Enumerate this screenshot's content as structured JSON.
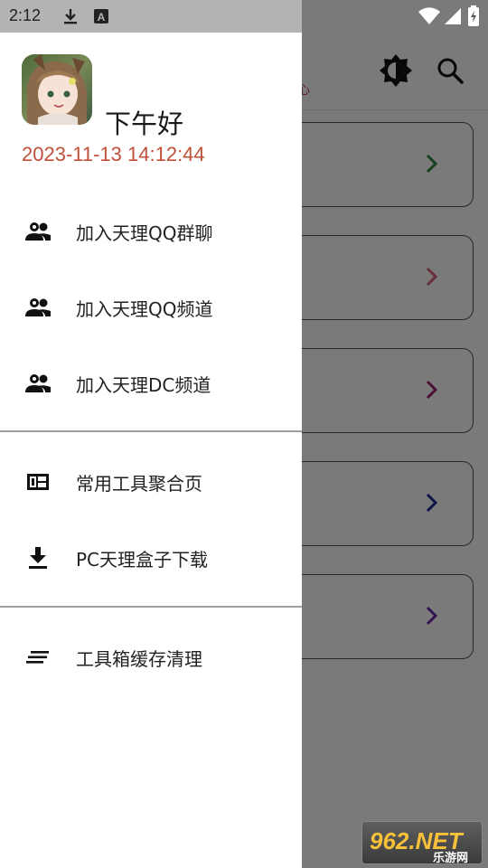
{
  "status_bar": {
    "time": "2:12",
    "icons": [
      "download-icon",
      "a-badge-icon",
      "wifi-icon",
      "signal-icon",
      "battery-icon"
    ]
  },
  "background_app": {
    "toolbar_icons": [
      "theme-toggle-icon",
      "search-icon"
    ],
    "toolbar_subtitle": "心",
    "chevron_colors": [
      "#2e8b3a",
      "#d9607a",
      "#8b2060",
      "#1c2a9a",
      "#5a2a9a"
    ]
  },
  "drawer": {
    "greeting": "下午好",
    "datetime": "2023-11-13 14:12:44",
    "group1": [
      {
        "icon": "people-icon",
        "label": "加入天理QQ群聊"
      },
      {
        "icon": "people-icon",
        "label": "加入天理QQ频道"
      },
      {
        "icon": "people-icon",
        "label": "加入天理DC频道"
      }
    ],
    "group2": [
      {
        "icon": "dashboard-icon",
        "label": "常用工具聚合页"
      },
      {
        "icon": "download-icon",
        "label": "PC天理盒子下载"
      }
    ],
    "group3": [
      {
        "icon": "clear-list-icon",
        "label": "工具箱缓存清理"
      }
    ]
  },
  "watermark": {
    "main": "962.NET",
    "sub": "乐游网"
  },
  "colors": {
    "datetime": "#c0503a",
    "scrim": "rgba(0,0,0,0.52)"
  }
}
